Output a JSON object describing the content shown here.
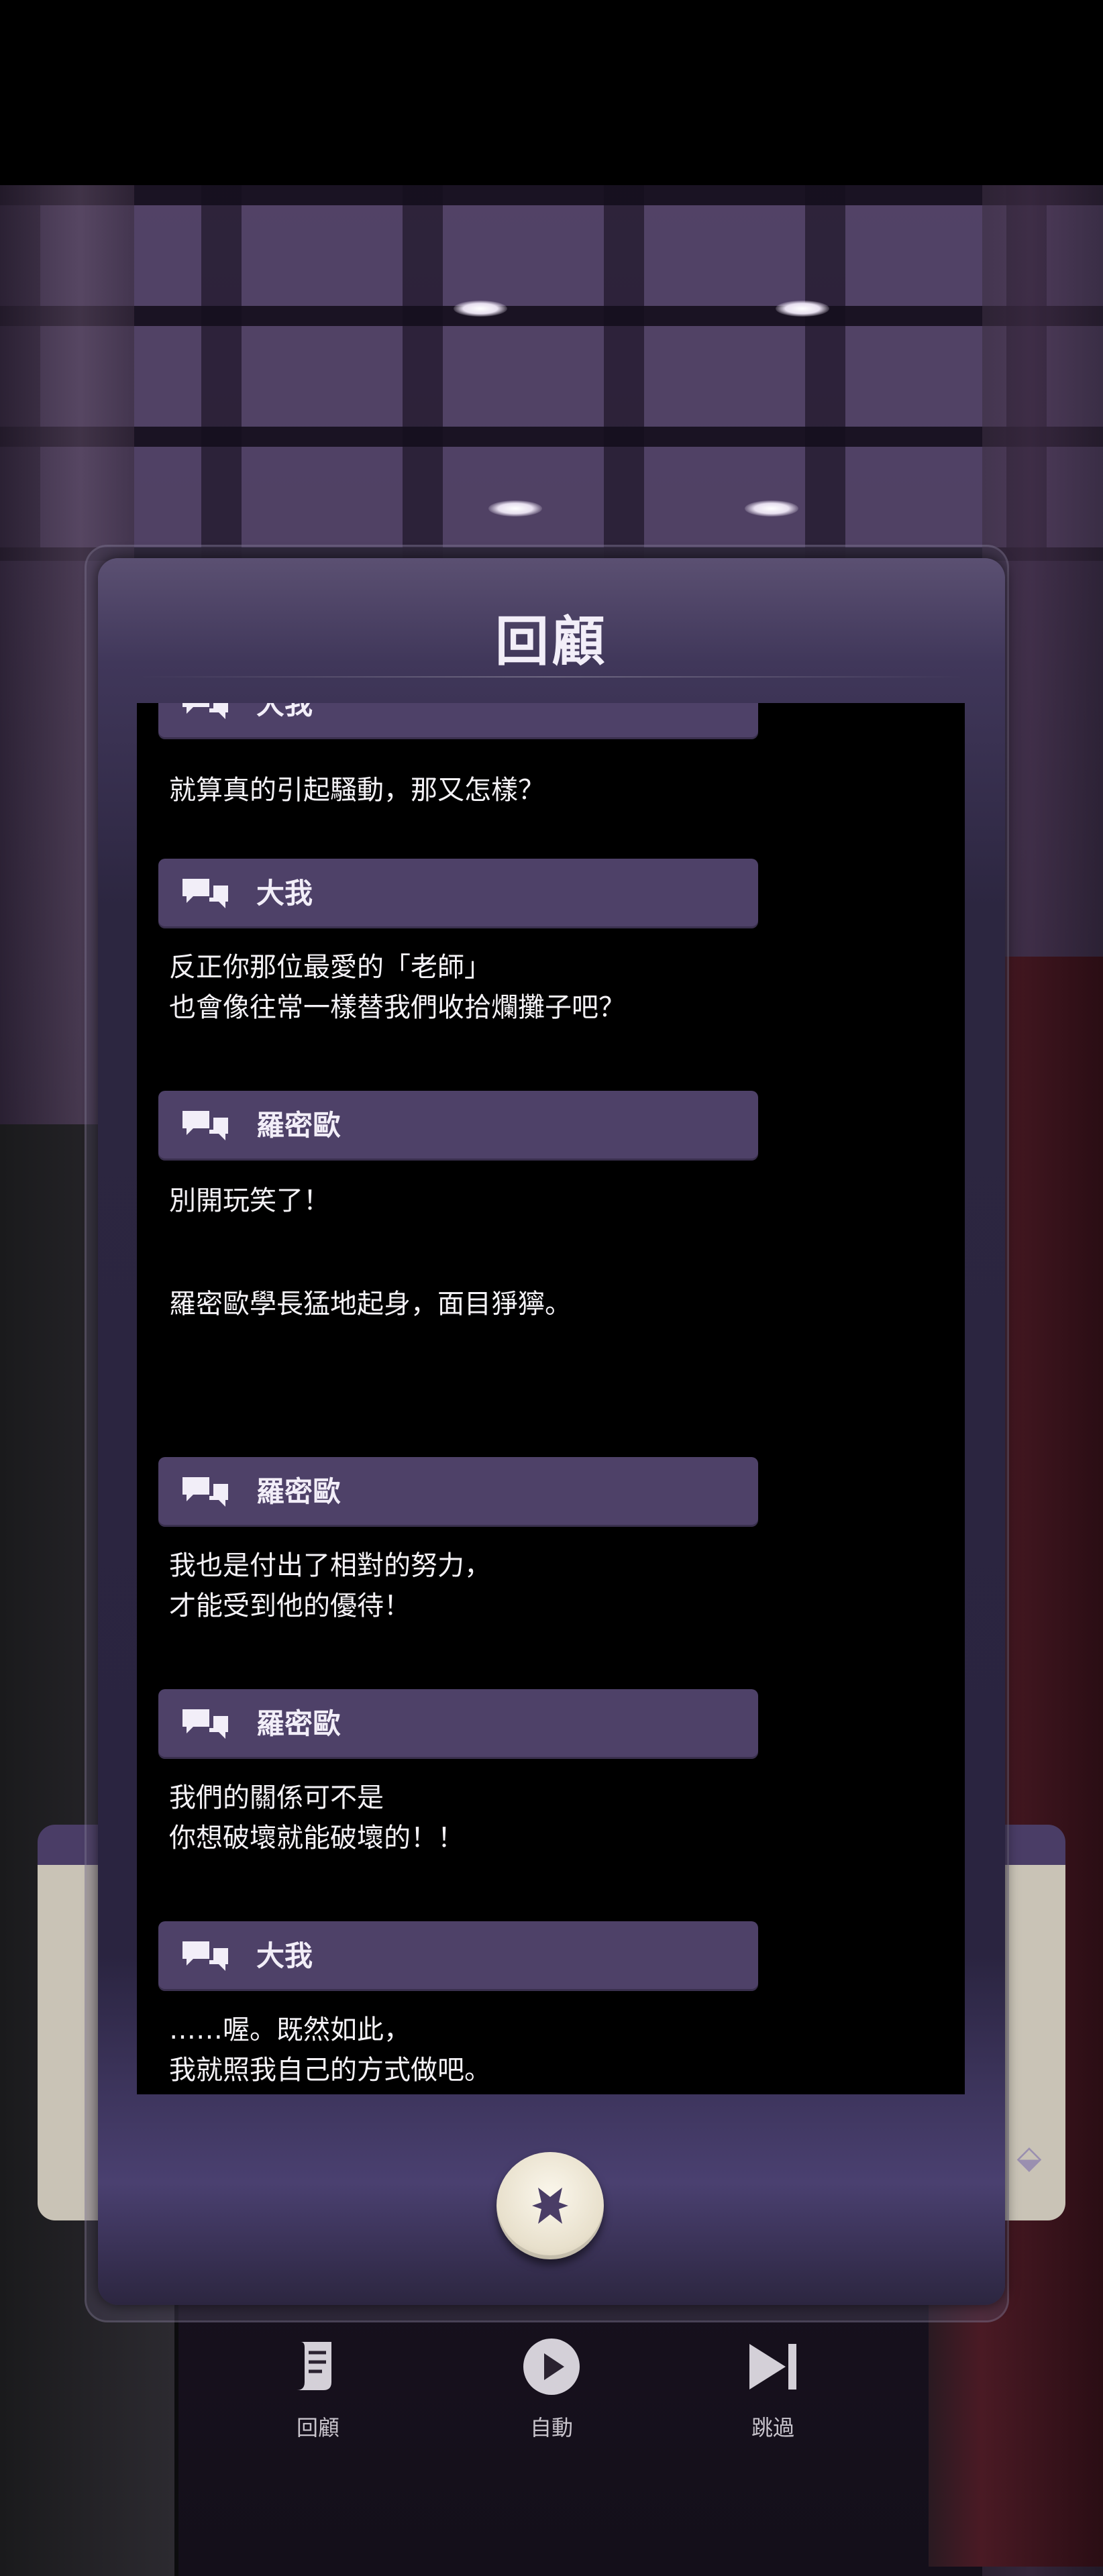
{
  "modal": {
    "title": "回顧",
    "entries": [
      {
        "speaker": "大我",
        "lines": [
          "就算真的引起騷動，那又怎樣？"
        ]
      },
      {
        "speaker": "大我",
        "lines": [
          "反正你那位最愛的「老師」",
          "也會像往常一樣替我們收拾爛攤子吧？"
        ]
      },
      {
        "speaker": "羅密歐",
        "lines": [
          "別開玩笑了！"
        ]
      },
      {
        "narration": "羅密歐學長猛地起身，面目猙獰。"
      },
      {
        "speaker": "羅密歐",
        "lines": [
          "我也是付出了相對的努力，",
          "才能受到他的優待！"
        ]
      },
      {
        "speaker": "羅密歐",
        "lines": [
          "我們的關係可不是",
          "你想破壞就能破壞的！！"
        ]
      },
      {
        "speaker": "大我",
        "lines": [
          "……喔。既然如此，",
          "我就照我自己的方式做吧。"
        ]
      }
    ],
    "close_icon": "close-icon"
  },
  "controls": {
    "log_label": "回顧",
    "auto_label": "自動",
    "skip_label": "跳過"
  },
  "colors": {
    "speaker_bar": "#4e4168",
    "modal_bg": "#2c2640",
    "log_bg": "#000000"
  }
}
